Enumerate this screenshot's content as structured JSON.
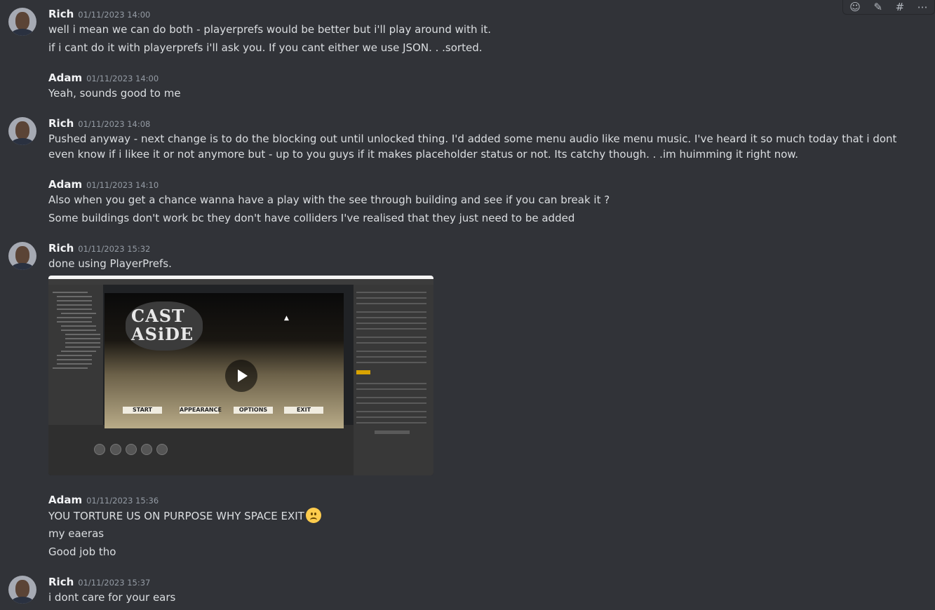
{
  "toolbar": {
    "icons": [
      "add-reaction-icon",
      "edit-icon",
      "create-thread-icon",
      "more-icon"
    ],
    "glyphs": [
      "☺",
      "✎",
      "#",
      "⋯"
    ]
  },
  "messages": [
    {
      "author": "Rich",
      "timestamp": "01/11/2023 14:00",
      "lines": [
        "well i mean we can do both - playerprefs would be better but i'll play around with it.",
        "if i cant do it with playerprefs i'll ask you. If you cant either we use JSON. . .sorted."
      ]
    },
    {
      "author": "Adam",
      "timestamp": "01/11/2023 14:00",
      "lines": [
        "Yeah, sounds good to me"
      ]
    },
    {
      "author": "Rich",
      "timestamp": "01/11/2023 14:08",
      "lines": [
        "Pushed anyway - next change is to do the blocking out until unlocked thing. I'd added some menu audio like menu music. I've heard it so much today that i dont even know if i likee it or not anymore but - up to you guys if it makes placeholder status or not. Its catchy though. . .im huimming it right now."
      ]
    },
    {
      "author": "Adam",
      "timestamp": "01/11/2023 14:10",
      "lines": [
        "Also when you get a chance wanna have a play with the see through building and see if you can break it ?",
        "Some buildings don't work bc they don't have colliders I've realised that they just need to be added"
      ]
    },
    {
      "author": "Rich",
      "timestamp": "01/11/2023 15:32",
      "lines": [
        "done using PlayerPrefs."
      ],
      "attachment": {
        "logo_line1": "CAST",
        "logo_line2": "ASiDE",
        "buttons": [
          "START",
          "APPEARANCE",
          "OPTIONS",
          "EXIT"
        ]
      }
    },
    {
      "author": "Adam",
      "timestamp": "01/11/2023 15:36",
      "lines": [
        "YOU TORTURE US ON PURPOSE WHY SPACE EXIT",
        "my eaeras",
        "Good job tho"
      ],
      "emoji": "frowning-face-emoji"
    },
    {
      "author": "Rich",
      "timestamp": "01/11/2023 15:37",
      "lines": [
        "i dont care for your ears"
      ]
    }
  ]
}
